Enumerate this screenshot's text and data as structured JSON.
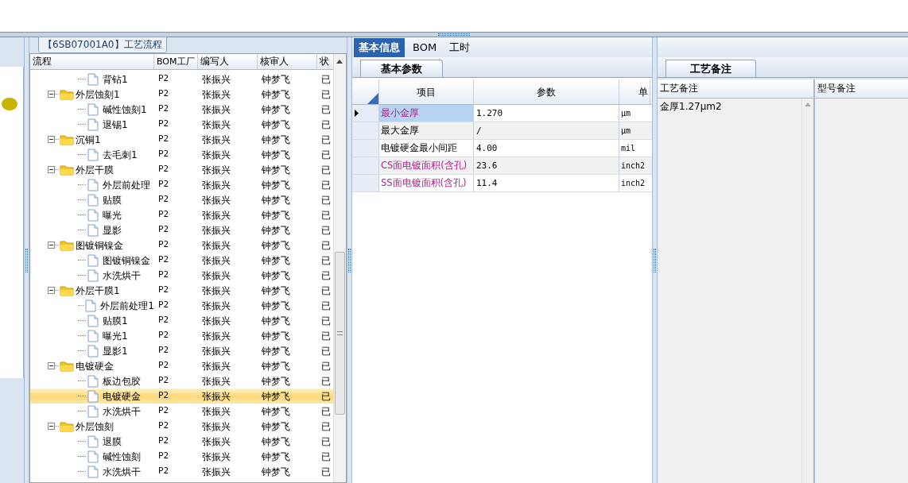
{
  "tooltip": "【6SB07001A0】工艺流程",
  "tree": {
    "name_column": "流程",
    "columns": [
      "BOM工厂",
      "编写人",
      "核审人",
      "状"
    ],
    "rows": [
      {
        "kind": "step",
        "name": "背钻1",
        "selected": false,
        "cells": [
          "P2",
          "张振兴",
          "钟梦飞",
          "已"
        ]
      },
      {
        "kind": "folder",
        "name": "外层蚀刻1",
        "expanded": true,
        "selected": false,
        "cells": [
          "P2",
          "张振兴",
          "钟梦飞",
          "已"
        ],
        "children": [
          {
            "kind": "step",
            "name": "碱性蚀刻1",
            "selected": false,
            "cells": [
              "P2",
              "张振兴",
              "钟梦飞",
              "已"
            ]
          },
          {
            "kind": "step",
            "name": "退锡1",
            "selected": false,
            "cells": [
              "P2",
              "张振兴",
              "钟梦飞",
              "已"
            ]
          }
        ]
      },
      {
        "kind": "folder",
        "name": "沉铜1",
        "expanded": true,
        "selected": false,
        "cells": [
          "P2",
          "张振兴",
          "钟梦飞",
          "已"
        ],
        "children": [
          {
            "kind": "step",
            "name": "去毛刺1",
            "selected": false,
            "cells": [
              "P2",
              "张振兴",
              "钟梦飞",
              "已"
            ]
          }
        ]
      },
      {
        "kind": "folder",
        "name": "外层干膜",
        "expanded": true,
        "selected": false,
        "cells": [
          "P2",
          "张振兴",
          "钟梦飞",
          "已"
        ],
        "children": [
          {
            "kind": "step",
            "name": "外层前处理",
            "selected": false,
            "cells": [
              "P2",
              "张振兴",
              "钟梦飞",
              "已"
            ]
          },
          {
            "kind": "step",
            "name": "贴膜",
            "selected": false,
            "cells": [
              "P2",
              "张振兴",
              "钟梦飞",
              "已"
            ]
          },
          {
            "kind": "step",
            "name": "曝光",
            "selected": false,
            "cells": [
              "P2",
              "张振兴",
              "钟梦飞",
              "已"
            ]
          },
          {
            "kind": "step",
            "name": "显影",
            "selected": false,
            "cells": [
              "P2",
              "张振兴",
              "钟梦飞",
              "已"
            ]
          }
        ]
      },
      {
        "kind": "folder",
        "name": "图镀铜镍金",
        "expanded": true,
        "selected": false,
        "cells": [
          "P2",
          "张振兴",
          "钟梦飞",
          "已"
        ],
        "children": [
          {
            "kind": "step",
            "name": "图镀铜镍金",
            "selected": false,
            "cells": [
              "P2",
              "张振兴",
              "钟梦飞",
              "已"
            ]
          },
          {
            "kind": "step",
            "name": "水洗烘干",
            "selected": false,
            "cells": [
              "P2",
              "张振兴",
              "钟梦飞",
              "已"
            ]
          }
        ]
      },
      {
        "kind": "folder",
        "name": "外层干膜1",
        "expanded": true,
        "selected": false,
        "cells": [
          "P2",
          "张振兴",
          "钟梦飞",
          "已"
        ],
        "children": [
          {
            "kind": "step",
            "name": "外层前处理1",
            "selected": false,
            "cells": [
              "P2",
              "张振兴",
              "钟梦飞",
              "已"
            ]
          },
          {
            "kind": "step",
            "name": "贴膜1",
            "selected": false,
            "cells": [
              "P2",
              "张振兴",
              "钟梦飞",
              "已"
            ]
          },
          {
            "kind": "step",
            "name": "曝光1",
            "selected": false,
            "cells": [
              "P2",
              "张振兴",
              "钟梦飞",
              "已"
            ]
          },
          {
            "kind": "step",
            "name": "显影1",
            "selected": false,
            "cells": [
              "P2",
              "张振兴",
              "钟梦飞",
              "已"
            ]
          }
        ]
      },
      {
        "kind": "folder",
        "name": "电镀硬金",
        "expanded": true,
        "selected": false,
        "cells": [
          "P2",
          "张振兴",
          "钟梦飞",
          "已"
        ],
        "children": [
          {
            "kind": "step",
            "name": "板边包胶",
            "selected": false,
            "cells": [
              "P2",
              "张振兴",
              "钟梦飞",
              "已"
            ]
          },
          {
            "kind": "step",
            "name": "电镀硬金",
            "selected": true,
            "cells": [
              "P2",
              "张振兴",
              "钟梦飞",
              "已"
            ]
          },
          {
            "kind": "step",
            "name": "水洗烘干",
            "selected": false,
            "cells": [
              "P2",
              "张振兴",
              "钟梦飞",
              "已"
            ]
          }
        ]
      },
      {
        "kind": "folder",
        "name": "外层蚀刻",
        "expanded": true,
        "selected": false,
        "cells": [
          "P2",
          "张振兴",
          "钟梦飞",
          "已"
        ],
        "children": [
          {
            "kind": "step",
            "name": "退膜",
            "selected": false,
            "cells": [
              "P2",
              "张振兴",
              "钟梦飞",
              "已"
            ]
          },
          {
            "kind": "step",
            "name": "碱性蚀刻",
            "selected": false,
            "cells": [
              "P2",
              "张振兴",
              "钟梦飞",
              "已"
            ]
          },
          {
            "kind": "step",
            "name": "水洗烘干",
            "selected": false,
            "cells": [
              "P2",
              "张振兴",
              "钟梦飞",
              "已"
            ]
          }
        ]
      }
    ]
  },
  "tabs": [
    {
      "label": "基本信息",
      "selected": true
    },
    {
      "label": "BOM",
      "selected": false
    },
    {
      "label": "工时",
      "selected": false
    }
  ],
  "params": {
    "tab": "基本参数",
    "columns": [
      "项目",
      "参数",
      "单"
    ],
    "rows": [
      {
        "item": "最小金厚",
        "value": "1.270",
        "unit": "µm",
        "highlighted": true,
        "selected": true
      },
      {
        "item": "最大金厚",
        "value": "/",
        "unit": "µm",
        "highlighted": false,
        "selected": false
      },
      {
        "item": "电镀硬金最小间距",
        "value": "4.00",
        "unit": "mil",
        "highlighted": false,
        "selected": false
      },
      {
        "item": "CS面电镀面积(含孔)",
        "value": "23.6",
        "unit": "inch2",
        "highlighted": true,
        "selected": false
      },
      {
        "item": "SS面电镀面积(含孔)",
        "value": "11.4",
        "unit": "inch2",
        "highlighted": true,
        "selected": false
      }
    ]
  },
  "notes": {
    "tab": "工艺备注",
    "columns": [
      "工艺备注",
      "型号备注"
    ],
    "process_note": "金厚1.27µm2"
  }
}
